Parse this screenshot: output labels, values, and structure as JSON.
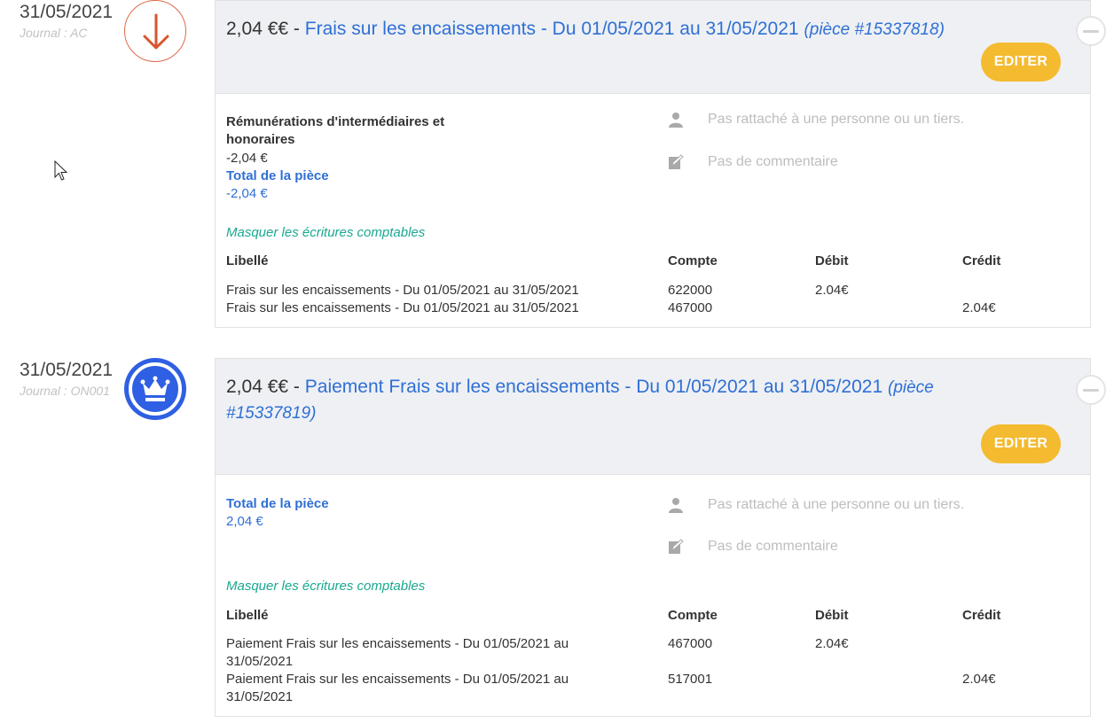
{
  "entries": [
    {
      "date": "31/05/2021",
      "journal": "Journal : AC",
      "icon": "arrow-down-icon",
      "amount": "2,04 €€",
      "separator": "-",
      "title": "Frais sur les encaissements - Du 01/05/2021 au 31/05/2021",
      "piece": "(pièce #15337818)",
      "edit_label": "EDITER",
      "account_name": "Rémunérations d'intermédiaires et honoraires",
      "account_amount": "-2,04 €",
      "total_label": "Total de la pièce",
      "total_value": "-2,04 €",
      "person_text": "Pas rattaché à une personne ou un tiers.",
      "comment_text": "Pas de commentaire",
      "toggle_label": "Masquer les écritures comptables",
      "columns": [
        "Libellé",
        "Compte",
        "Débit",
        "Crédit"
      ],
      "rows": [
        {
          "label": "Frais sur les encaissements - Du 01/05/2021 au 31/05/2021",
          "account": "622000",
          "debit": "2.04€",
          "credit": ""
        },
        {
          "label": "Frais sur les encaissements - Du 01/05/2021 au 31/05/2021",
          "account": "467000",
          "debit": "",
          "credit": "2.04€"
        }
      ]
    },
    {
      "date": "31/05/2021",
      "journal": "Journal : ON001",
      "icon": "crown-icon",
      "amount": "2,04 €€",
      "separator": "-",
      "title": "Paiement Frais sur les encaissements - Du 01/05/2021 au 31/05/2021",
      "piece": "(pièce #15337819)",
      "edit_label": "EDITER",
      "total_label": "Total de la pièce",
      "total_value": "2,04 €",
      "person_text": "Pas rattaché à une personne ou un tiers.",
      "comment_text": "Pas de commentaire",
      "toggle_label": "Masquer les écritures comptables",
      "columns": [
        "Libellé",
        "Compte",
        "Débit",
        "Crédit"
      ],
      "rows": [
        {
          "label": "Paiement Frais sur les encaissements - Du 01/05/2021 au 31/05/2021",
          "account": "467000",
          "debit": "2.04€",
          "credit": ""
        },
        {
          "label": "Paiement Frais sur les encaissements - Du 01/05/2021 au 31/05/2021",
          "account": "517001",
          "debit": "",
          "credit": "2.04€"
        }
      ]
    }
  ],
  "colors": {
    "link": "#2f6fd6",
    "toggle": "#1aa890",
    "edit_button": "#f4bb30",
    "out_icon": "#e0694a",
    "bank_icon": "#2f5fe3"
  }
}
